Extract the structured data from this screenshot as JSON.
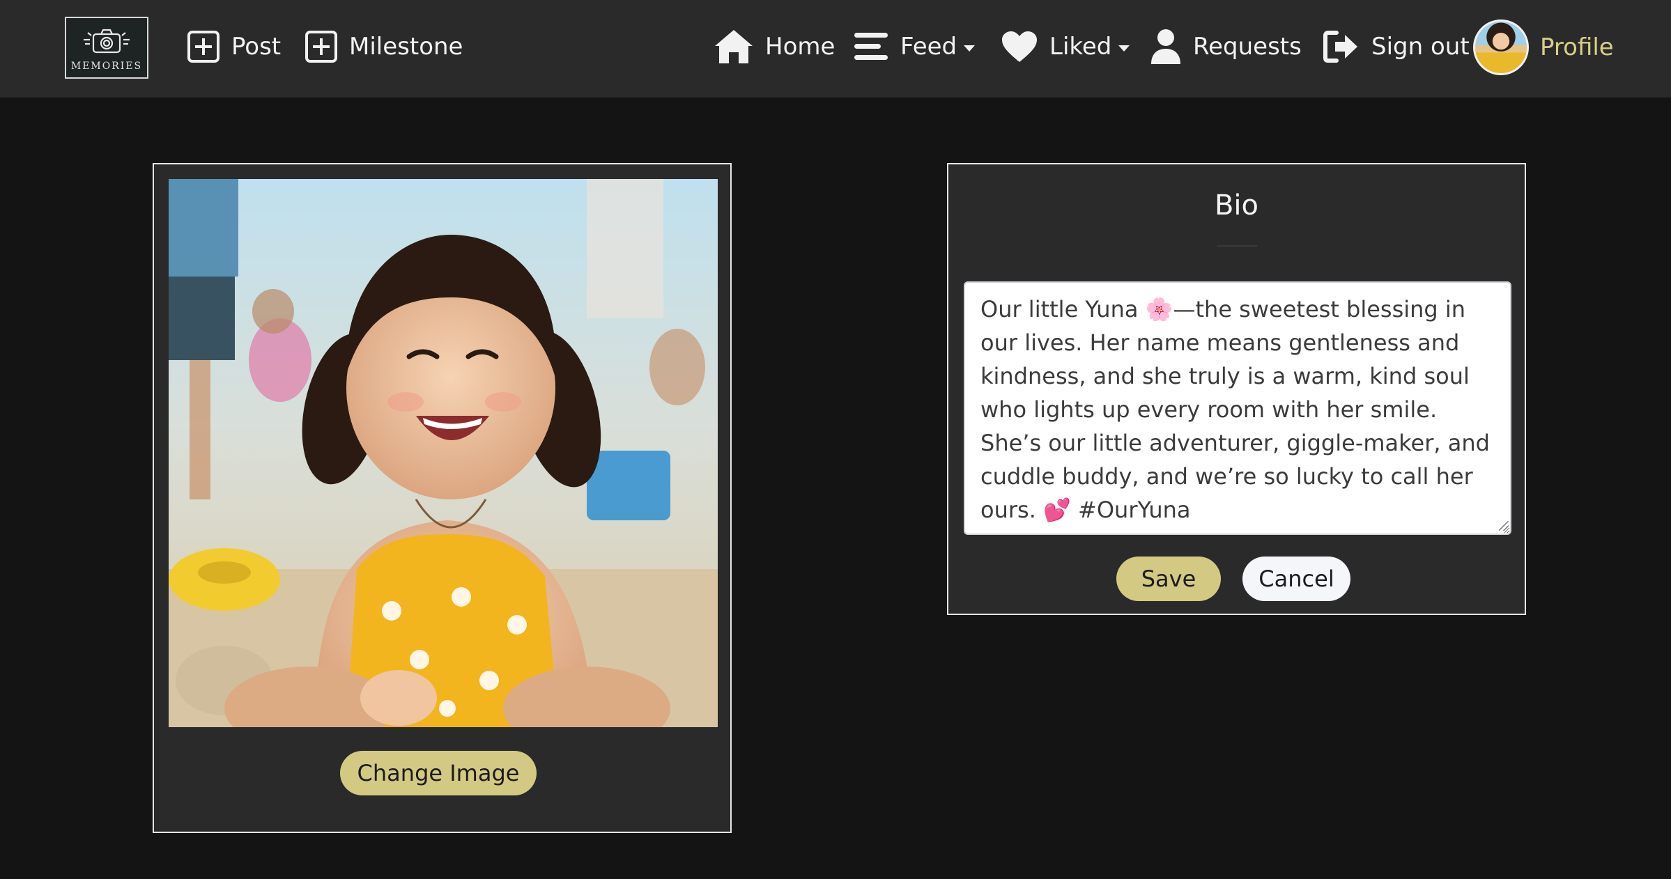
{
  "navbar": {
    "logo_text": "MEMORIES",
    "post_label": "Post",
    "milestone_label": "Milestone",
    "home_label": "Home",
    "feed_label": "Feed",
    "liked_label": "Liked",
    "requests_label": "Requests",
    "signout_label": "Sign out",
    "profile_label": "Profile",
    "icons": [
      "camera-logo-icon",
      "plus-square-icon",
      "home-icon",
      "bars-icon",
      "heart-icon",
      "user-icon",
      "sign-out-icon",
      "caret-down-icon"
    ]
  },
  "image_card": {
    "change_image_label": "Change Image",
    "photo_alt": "Smiling toddler in a yellow floral swimsuit on a beach"
  },
  "bio_card": {
    "title": "Bio",
    "bio_text": "Our little Yuna 🌸—the sweetest blessing in our lives. Her name means gentleness and kindness, and she truly is a warm, kind soul who lights up every room with her smile. She’s our little adventurer, giggle-maker, and cuddle buddy, and we’re so lucky to call her ours. 💕 #OurYuna",
    "save_label": "Save",
    "cancel_label": "Cancel"
  },
  "colors": {
    "background": "#141414",
    "navbar": "#2a2a2a",
    "card": "#2a2a2a",
    "accent_gold": "#d3c982",
    "profile_text": "#d9cf86"
  }
}
